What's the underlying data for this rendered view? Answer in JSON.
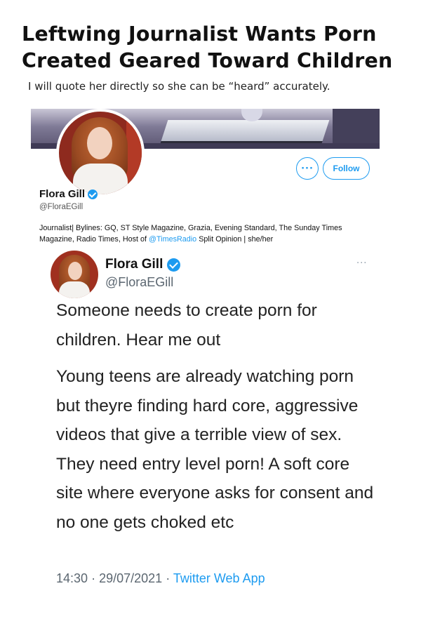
{
  "headline": {
    "line1": "Leftwing Journalist Wants Porn",
    "line2": "Created Geared Toward Children",
    "subtitle": "I will quote her directly so she can be “heard” accurately."
  },
  "profile": {
    "name": "Flora Gill",
    "handle": "@FloraEGill",
    "more_label": "···",
    "follow_label": "Follow",
    "bio_prefix": "Journalist| Bylines: GQ, ST Style Magazine, Grazia, Evening Standard, The Sunday Times Magazine, Radio Times, Host of",
    "bio_link": "@TimesRadio",
    "bio_suffix": "Split Opinion | she/her",
    "link_color": "#1d9bf0"
  },
  "tweet": {
    "name": "Flora Gill",
    "handle": "@FloraEGill",
    "more_label": "···",
    "paragraph1": "Someone needs to create porn for children. Hear me out",
    "paragraph2": "Young teens are already watching porn but theyre finding hard core, aggressive videos that give a terrible view of sex. They need entry level porn! A soft core site where everyone asks for consent and no one gets choked etc",
    "time": "14:30",
    "separator": "·",
    "date": "29/07/2021",
    "source": "Twitter Web App"
  },
  "icons": {
    "verified": "verified-badge-icon",
    "more": "more-options-icon"
  }
}
